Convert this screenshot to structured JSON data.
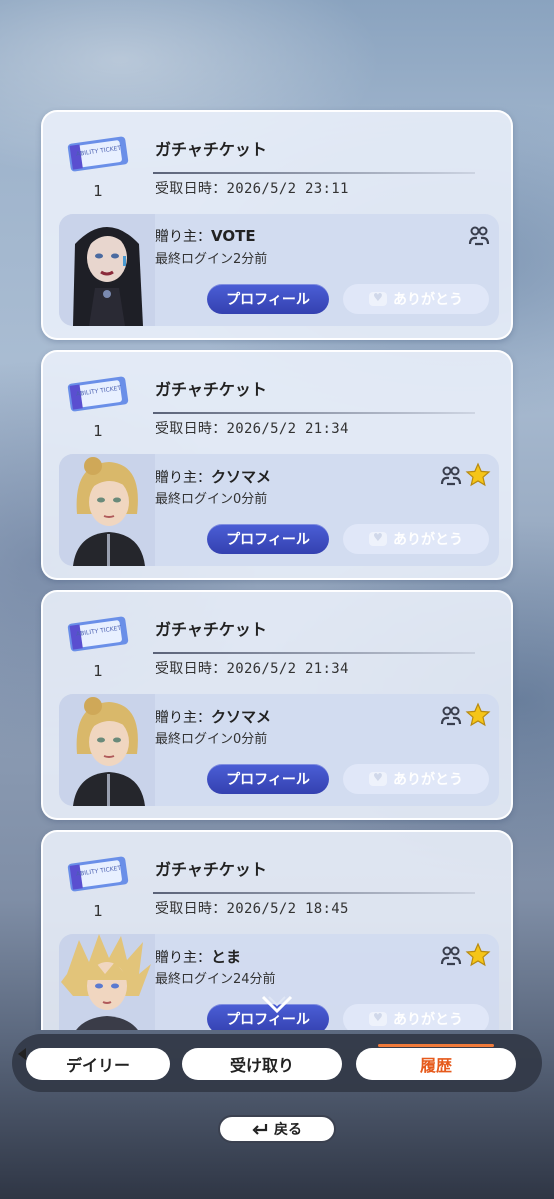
{
  "gifts": [
    {
      "item_name": "ガチャチケット",
      "quantity": "1",
      "received_at": "受取日時：2026/5/2 23:11",
      "sender_label": "贈り主：",
      "sender_name": "VOTE",
      "last_login": "最終ログイン2分前",
      "favorite": false,
      "avatar": "avatar-dark-hair",
      "profile_label": "プロフィール",
      "thanks_label": "ありがとう"
    },
    {
      "item_name": "ガチャチケット",
      "quantity": "1",
      "received_at": "受取日時：2026/5/2 21:34",
      "sender_label": "贈り主：",
      "sender_name": "クソマメ",
      "last_login": "最終ログイン0分前",
      "favorite": true,
      "avatar": "avatar-blonde",
      "profile_label": "プロフィール",
      "thanks_label": "ありがとう"
    },
    {
      "item_name": "ガチャチケット",
      "quantity": "1",
      "received_at": "受取日時：2026/5/2 21:34",
      "sender_label": "贈り主：",
      "sender_name": "クソマメ",
      "last_login": "最終ログイン0分前",
      "favorite": true,
      "avatar": "avatar-blonde",
      "profile_label": "プロフィール",
      "thanks_label": "ありがとう"
    },
    {
      "item_name": "ガチャチケット",
      "quantity": "1",
      "received_at": "受取日時：2026/5/2 18:45",
      "sender_label": "贈り主：",
      "sender_name": "とま",
      "last_login": "最終ログイン24分前",
      "favorite": true,
      "avatar": "avatar-spiky-blond",
      "profile_label": "プロフィール",
      "thanks_label": "ありがとう"
    }
  ],
  "ticket_label": "ABILITY TICKET",
  "tabs": {
    "daily": "デイリー",
    "receive": "受け取り",
    "history": "履歴",
    "active": "history"
  },
  "back_label": "戻る",
  "colors": {
    "profile_button": "#3a4bc4",
    "active_tab_text": "#e65a1c",
    "favorite_star": "#f5c518"
  }
}
